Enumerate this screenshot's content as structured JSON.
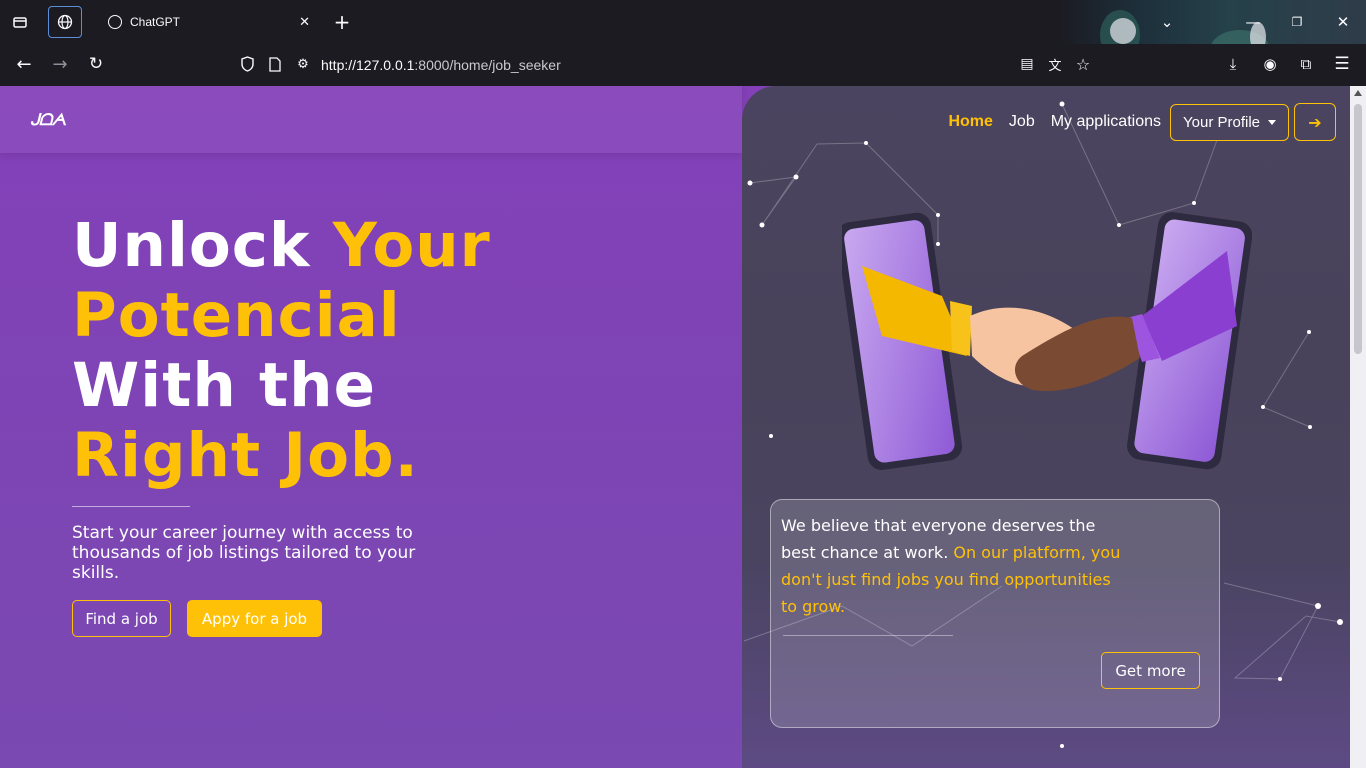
{
  "browser": {
    "tab_title": "ChatGPT",
    "url_prefix": "http://127.0.0.1",
    "url_rest": ":8000/home/job_seeker"
  },
  "header": {
    "logo": "ᒍᗝᗅ"
  },
  "nav": {
    "home": "Home",
    "job": "Job",
    "applications": "My applications",
    "profile": "Your Profile"
  },
  "hero": {
    "line1_white": "Unlock ",
    "line1_yellow": "Your",
    "line2_yellow": "Potencial",
    "line3_white": "With the",
    "line4_yellow": "Right Job.",
    "subtitle": "Start your career journey with access to thousands of job listings tailored to your skills.",
    "find_job": "Find a job",
    "apply_job": "Appy for a job"
  },
  "card": {
    "text_white": "We believe that everyone deserves the best chance at work. ",
    "text_yellow": "On our platform, you don't just find jobs you find opportunities to grow.",
    "button": "Get more"
  },
  "colors": {
    "accent": "#ffc107",
    "page_bg": "#8440b9",
    "right_panel": "#4b4460"
  }
}
